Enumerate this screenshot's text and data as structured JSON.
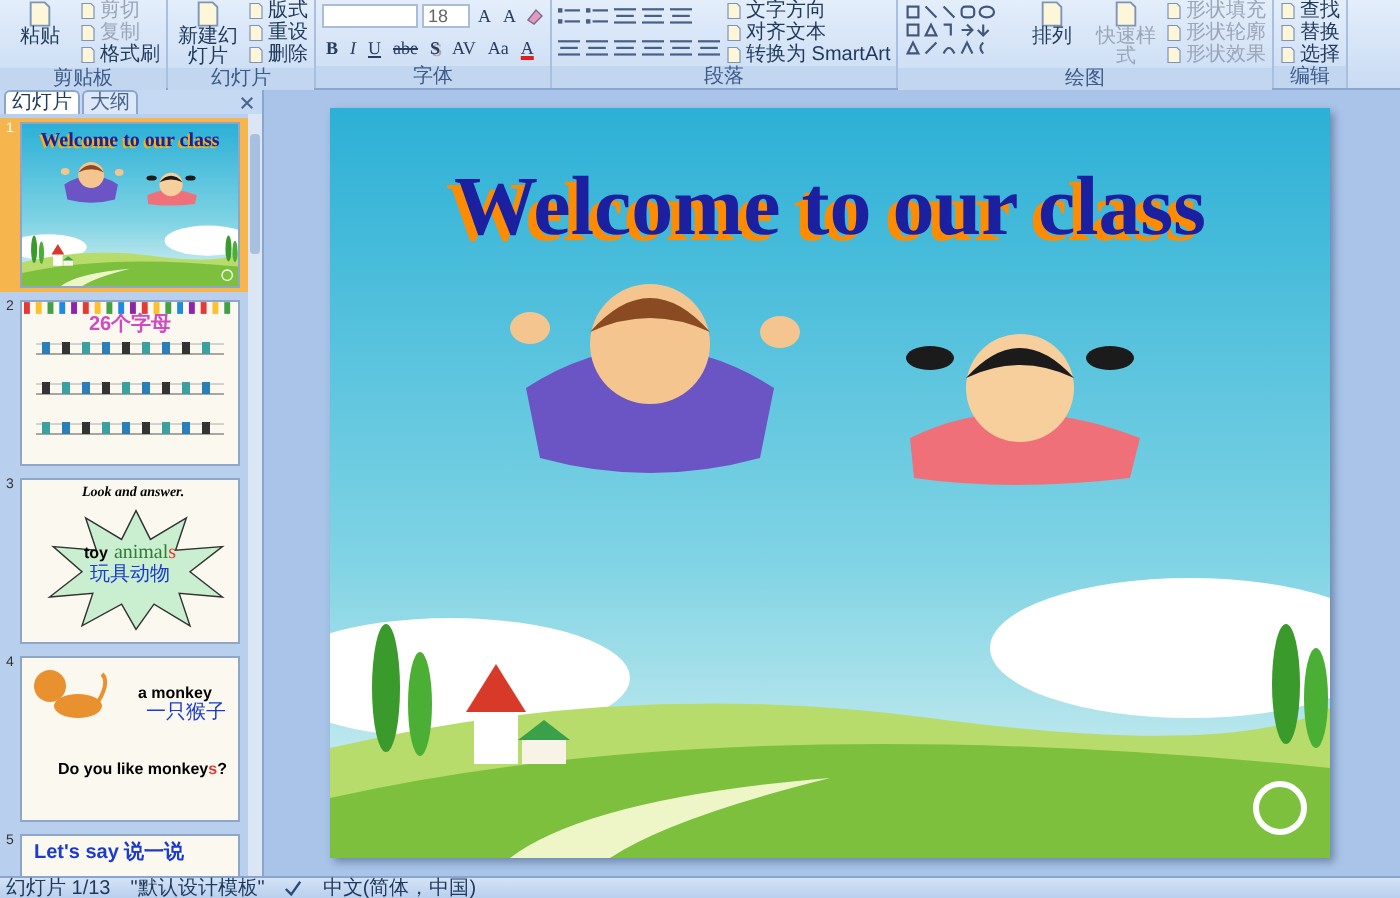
{
  "ribbon": {
    "groups": [
      {
        "label": "剪贴板",
        "columns": [
          [
            {
              "kind": "large",
              "label": "粘贴",
              "disabled": false
            }
          ],
          [
            {
              "kind": "small",
              "label": "剪切",
              "disabled": true
            },
            {
              "kind": "small",
              "label": "复制",
              "disabled": true
            },
            {
              "kind": "small",
              "label": "格式刷",
              "disabled": false
            }
          ]
        ]
      },
      {
        "label": "幻灯片",
        "columns": [
          [
            {
              "kind": "large",
              "label": "新建幻灯片",
              "disabled": false
            }
          ],
          [
            {
              "kind": "small",
              "label": "版式",
              "disabled": false
            },
            {
              "kind": "small",
              "label": "重设",
              "disabled": false
            },
            {
              "kind": "small",
              "label": "删除",
              "disabled": false
            }
          ]
        ]
      },
      {
        "label": "字体",
        "columns": [
          [
            {
              "kind": "row",
              "items": [
                {
                  "kind": "font-field"
                },
                {
                  "kind": "size-field",
                  "value": "18"
                },
                {
                  "kind": "glyph",
                  "label": "A"
                },
                {
                  "kind": "glyph",
                  "label": "A"
                },
                {
                  "kind": "clear-tool"
                }
              ]
            },
            {
              "kind": "row",
              "items": [
                {
                  "kind": "glyph",
                  "label": "B"
                },
                {
                  "kind": "glyph",
                  "label": "I"
                },
                {
                  "kind": "glyph",
                  "label": "U"
                },
                {
                  "kind": "glyph",
                  "label": "abe"
                },
                {
                  "kind": "glyph",
                  "label": "S"
                },
                {
                  "kind": "glyph",
                  "label": "AV"
                },
                {
                  "kind": "glyph",
                  "label": "Aa"
                },
                {
                  "kind": "glyph",
                  "label": "A"
                }
              ]
            }
          ]
        ]
      },
      {
        "label": "段落",
        "columns": [
          [
            {
              "kind": "list-tools"
            },
            {
              "kind": "align-tools"
            }
          ],
          [
            {
              "kind": "small",
              "label": "文字方向",
              "disabled": false
            },
            {
              "kind": "small",
              "label": "对齐文本",
              "disabled": false
            },
            {
              "kind": "small",
              "label": "转换为 SmartArt",
              "disabled": false
            }
          ]
        ]
      },
      {
        "label": "绘图",
        "columns": [
          [
            {
              "kind": "shape-gallery"
            }
          ],
          [
            {
              "kind": "large",
              "label": "排列",
              "disabled": false
            }
          ],
          [
            {
              "kind": "large",
              "label": "快速样式",
              "disabled": true
            }
          ],
          [
            {
              "kind": "small",
              "label": "形状填充",
              "disabled": true
            },
            {
              "kind": "small",
              "label": "形状轮廓",
              "disabled": true
            },
            {
              "kind": "small",
              "label": "形状效果",
              "disabled": true
            }
          ]
        ]
      },
      {
        "label": "编辑",
        "columns": [
          [
            {
              "kind": "small",
              "label": "查找",
              "disabled": false
            },
            {
              "kind": "small",
              "label": "替换",
              "disabled": false
            },
            {
              "kind": "small",
              "label": "选择",
              "disabled": false
            }
          ]
        ]
      }
    ]
  },
  "panel": {
    "tabs": [
      {
        "label": "幻灯片",
        "selected": true
      },
      {
        "label": "大纲",
        "selected": false
      }
    ],
    "slides": [
      {
        "number": "1",
        "selected": true,
        "kind": "title",
        "title": "Welcome to our class"
      },
      {
        "number": "2",
        "selected": false,
        "kind": "letters",
        "title": "26个字母"
      },
      {
        "number": "3",
        "selected": false,
        "kind": "burst",
        "heading": "Look and answer.",
        "label": "toy",
        "parts": [
          {
            "text": "animal",
            "highlight": false
          },
          {
            "text": "s",
            "highlight": true
          }
        ],
        "caption": "玩具动物"
      },
      {
        "number": "4",
        "selected": false,
        "kind": "monkey",
        "heading": "a monkey",
        "caption": "一只猴子",
        "parts": [
          {
            "text": "Do you like monkey",
            "highlight": false
          },
          {
            "text": "s",
            "highlight": true
          },
          {
            "text": "?",
            "highlight": false
          }
        ]
      },
      {
        "number": "5",
        "selected": false,
        "kind": "say",
        "heading": "Let's say 说一说"
      }
    ]
  },
  "slide": {
    "title": "Welcome to our class"
  },
  "status_bar": {
    "items": [
      "幻灯片 1/13",
      "\"默认设计模板\"",
      "中文(简体，中国)"
    ]
  }
}
